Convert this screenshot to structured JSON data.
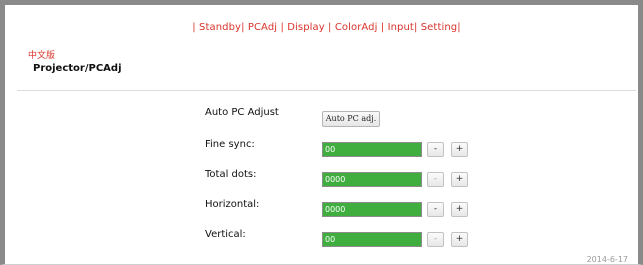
{
  "nav": {
    "sep": "|",
    "items": [
      "Standby",
      "PCAdj",
      "Display",
      "ColorAdj",
      "Input",
      "Setting"
    ]
  },
  "lang_link": "中文版",
  "page_title": "Projector/PCAdj",
  "auto_adjust": {
    "label": "Auto PC Adjust",
    "button": "Auto PC adj."
  },
  "controls": [
    {
      "label": "Fine sync:",
      "value": "00",
      "minus": "-",
      "plus": "+",
      "minus_enabled": true
    },
    {
      "label": "Total dots:",
      "value": "0000",
      "minus": "-",
      "plus": "+",
      "minus_enabled": false
    },
    {
      "label": "Horizontal:",
      "value": "0000",
      "minus": "-",
      "plus": "+",
      "minus_enabled": true
    },
    {
      "label": "Vertical:",
      "value": "00",
      "minus": "-",
      "plus": "+",
      "minus_enabled": false
    }
  ],
  "date": "2014-6-17",
  "colors": {
    "accent": "#d9342b",
    "bar": "#3fae3f",
    "frame": "#8a8a8a"
  }
}
